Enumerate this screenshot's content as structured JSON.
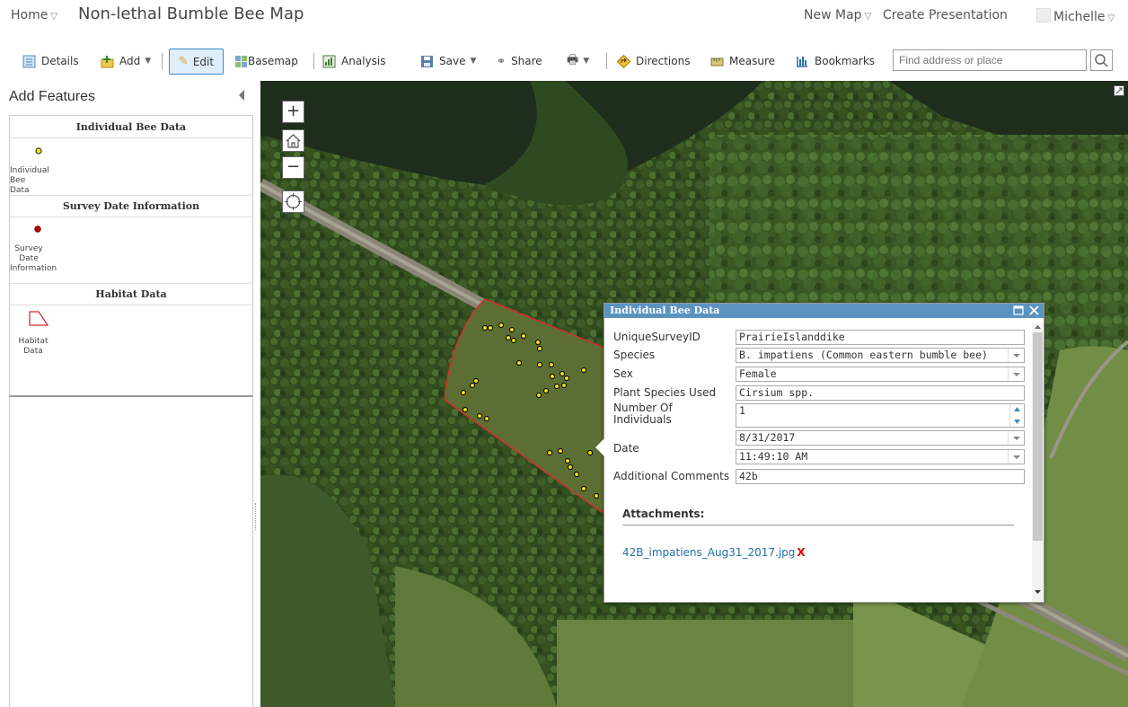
{
  "header": {
    "home_label": "Home",
    "map_title": "Non-lethal Bumble Bee Map",
    "new_map_label": "New Map",
    "create_presentation_label": "Create Presentation",
    "user_name": "Michelle"
  },
  "toolbar": {
    "details_label": "Details",
    "add_label": "Add",
    "edit_label": "Edit",
    "basemap_label": "Basemap",
    "analysis_label": "Analysis",
    "save_label": "Save",
    "share_label": "Share",
    "directions_label": "Directions",
    "measure_label": "Measure",
    "bookmarks_label": "Bookmarks",
    "search_placeholder": "Find address or place"
  },
  "sidebar": {
    "title": "Add Features",
    "groups": [
      {
        "header": "Individual Bee Data",
        "template_label_lines": [
          "Individual",
          "Bee Data"
        ],
        "symbol": "yellow-point"
      },
      {
        "header": "Survey Date Information",
        "template_label_lines": [
          "Survey",
          "Date",
          "Information"
        ],
        "symbol": "red-point"
      },
      {
        "header": "Habitat Data",
        "template_label_lines": [
          "Habitat",
          "Data"
        ],
        "symbol": "red-polygon"
      }
    ]
  },
  "popup": {
    "title": "Individual Bee Data",
    "fields": {
      "unique_survey_id": {
        "label": "UniqueSurveyID",
        "value": "PrairieIslanddike"
      },
      "species": {
        "label": "Species",
        "value": "B. impatiens (Common eastern bumble bee)"
      },
      "sex": {
        "label": "Sex",
        "value": "Female"
      },
      "plant_species": {
        "label": "Plant Species Used",
        "value": "Cirsium spp."
      },
      "number_individuals": {
        "label_lines": [
          "Number Of",
          "Individuals"
        ],
        "value": "1"
      },
      "date": {
        "label": "Date",
        "date_value": "8/31/2017",
        "time_value": "11:49:10 AM"
      },
      "comments": {
        "label": "Additional Comments",
        "value": "42b"
      }
    },
    "attachments_header": "Attachments:",
    "attachment_file": "42B_impatiens_Aug31_2017.jpg",
    "attachment_remove": "X"
  },
  "colors": {
    "accent": "#5b93c0",
    "link": "#1f6fae",
    "habitat_outline": "#d32f2f",
    "bee_point": "#ffee00",
    "survey_point": "#c00000"
  }
}
